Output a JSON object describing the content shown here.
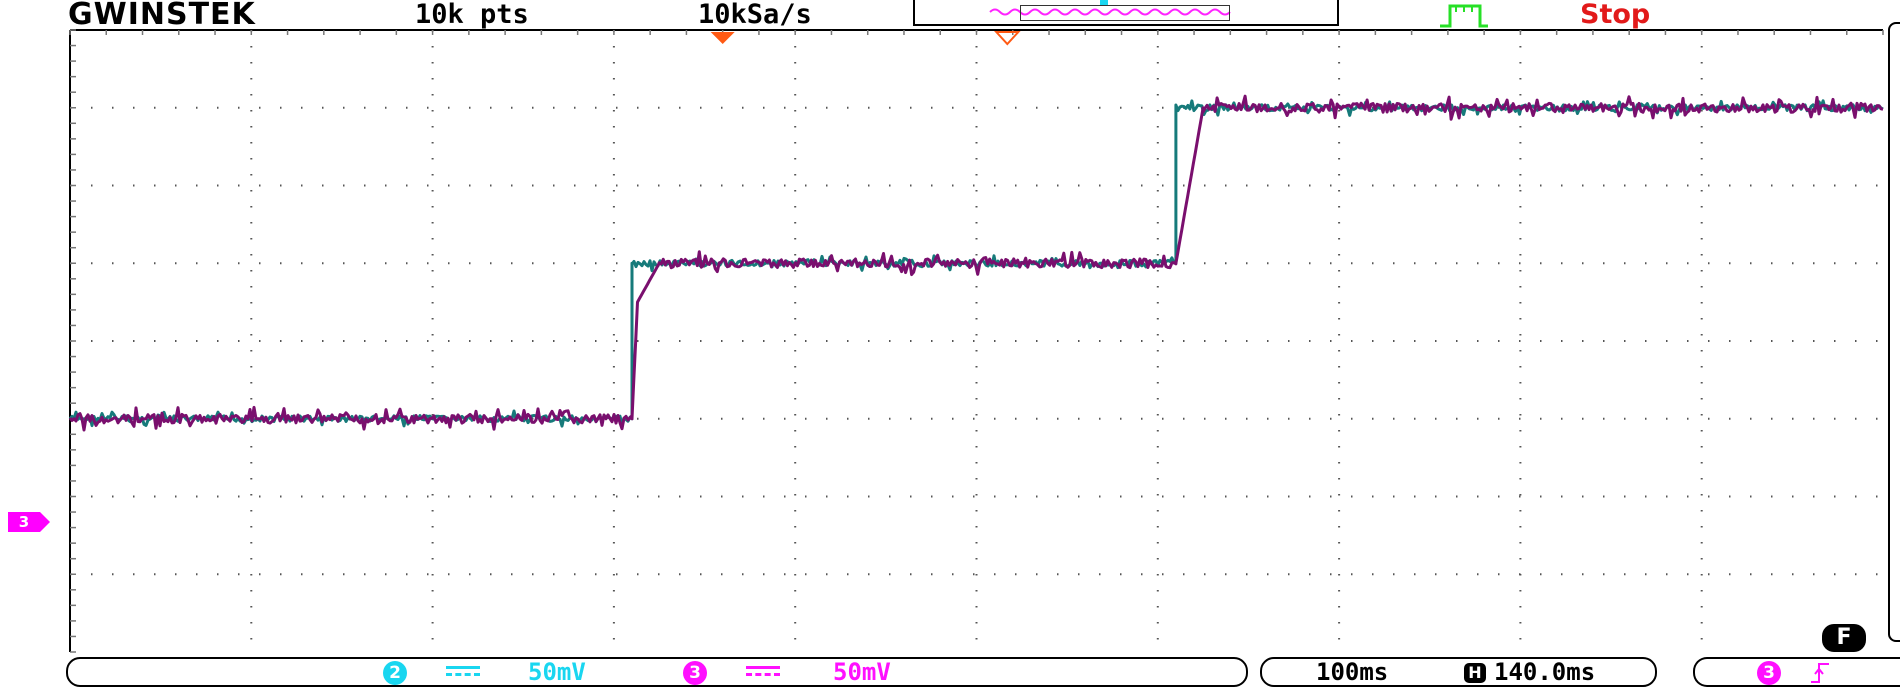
{
  "header": {
    "brand": "GWINSTEK",
    "record_length": "10k pts",
    "sample_rate": "10kSa/s",
    "status": "Stop"
  },
  "channels": [
    {
      "number": "2",
      "coupling_icon": "dc-coupling-icon",
      "scale": "50mV",
      "color": "#19d6f0"
    },
    {
      "number": "3",
      "coupling_icon": "dc-coupling-icon",
      "scale": "50mV",
      "color": "#ff10ff"
    }
  ],
  "timebase": {
    "scale": "100ms",
    "position_icon": "H",
    "position": "140.0ms"
  },
  "trigger": {
    "source": "3",
    "slope_icon": "rising-edge-icon",
    "trigger_type_icon": "pulse-icon"
  },
  "soft_key": "F",
  "ch3_marker_label": "3",
  "colors": {
    "grid_dots": "#555555",
    "ch2_trace": "#167a7a",
    "ch3_trace": "#7a0f6e",
    "trigger_marker": "#ff5a14",
    "trigger_icon": "#27e027",
    "status": "#e21a1a"
  },
  "chart_data": {
    "type": "line",
    "x_divisions": 10,
    "y_divisions": 8,
    "time_per_div_ms": 100,
    "volts_per_div_mV": 50,
    "series": [
      {
        "channel": "2",
        "x_div": [
          0,
          3.1,
          3.1,
          6.1,
          6.1,
          10
        ],
        "y_div": [
          -1,
          -1,
          1,
          1,
          3,
          3
        ]
      },
      {
        "channel": "3",
        "x_div": [
          0,
          3.1,
          3.13,
          3.25,
          6.1,
          6.25,
          10
        ],
        "y_div": [
          -1,
          -1,
          0.5,
          1,
          1,
          3,
          3
        ]
      }
    ]
  }
}
